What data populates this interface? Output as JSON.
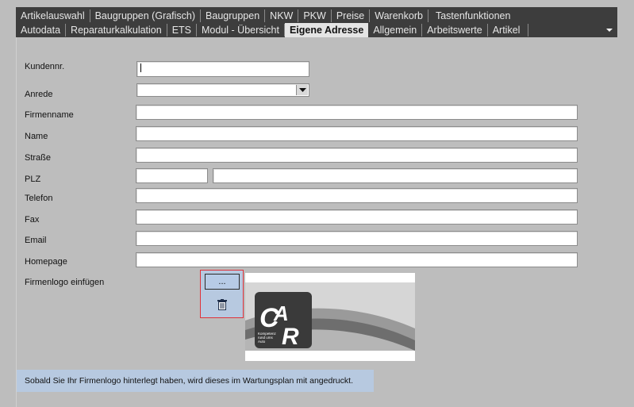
{
  "tabs": {
    "row1": [
      {
        "label": "Artikelauswahl"
      },
      {
        "label": "Baugruppen (Grafisch)"
      },
      {
        "label": "Baugruppen"
      },
      {
        "label": "NKW"
      },
      {
        "label": "PKW"
      },
      {
        "label": "Preise"
      },
      {
        "label": "Warenkorb"
      },
      {
        "label": "Tastenfunktionen"
      }
    ],
    "row2": [
      {
        "label": "Autodata"
      },
      {
        "label": "Reparaturkalkulation"
      },
      {
        "label": "ETS"
      },
      {
        "label": "Modul - Übersicht"
      },
      {
        "label": "Eigene Adresse",
        "active": true
      },
      {
        "label": "Allgemein"
      },
      {
        "label": "Arbeitswerte"
      },
      {
        "label": "Artikel"
      }
    ],
    "menu_icon": "chevron-down-icon"
  },
  "form": {
    "kundennr": {
      "label": "Kundennr.",
      "value": ""
    },
    "anrede": {
      "label": "Anrede",
      "value": ""
    },
    "firmenname": {
      "label": "Firmenname",
      "value": ""
    },
    "name": {
      "label": "Name",
      "value": ""
    },
    "strasse": {
      "label": "Straße",
      "value": ""
    },
    "plz": {
      "label": "PLZ",
      "value": "",
      "ort_value": ""
    },
    "telefon": {
      "label": "Telefon",
      "value": ""
    },
    "fax": {
      "label": "Fax",
      "value": ""
    },
    "email": {
      "label": "Email",
      "value": ""
    },
    "homepage": {
      "label": "Homepage",
      "value": ""
    }
  },
  "logo": {
    "label": "Firmenlogo einfügen",
    "browse_label": "...",
    "delete_icon": "trash-icon",
    "preview_icon": "car-logo",
    "preview_text": "Kompetenz rund ums Auto"
  },
  "info_text": "Sobald Sie Ihr Firmenlogo hinterlegt haben, wird dieses im Wartungsplan mit angedruckt.",
  "colors": {
    "accent_highlight": "#e0323a",
    "info_bg": "#b7c9e0",
    "tabbar_bg": "#3d3d3d"
  }
}
